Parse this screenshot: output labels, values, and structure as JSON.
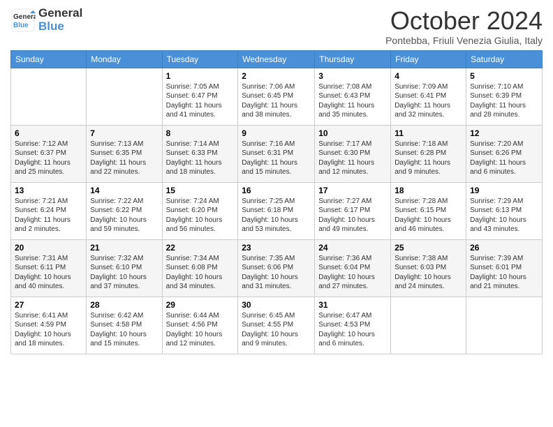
{
  "logo": {
    "general": "General",
    "blue": "Blue"
  },
  "header": {
    "month": "October 2024",
    "location": "Pontebba, Friuli Venezia Giulia, Italy"
  },
  "weekdays": [
    "Sunday",
    "Monday",
    "Tuesday",
    "Wednesday",
    "Thursday",
    "Friday",
    "Saturday"
  ],
  "weeks": [
    [
      {
        "day": "",
        "sunrise": "",
        "sunset": "",
        "daylight": ""
      },
      {
        "day": "",
        "sunrise": "",
        "sunset": "",
        "daylight": ""
      },
      {
        "day": "1",
        "sunrise": "Sunrise: 7:05 AM",
        "sunset": "Sunset: 6:47 PM",
        "daylight": "Daylight: 11 hours and 41 minutes."
      },
      {
        "day": "2",
        "sunrise": "Sunrise: 7:06 AM",
        "sunset": "Sunset: 6:45 PM",
        "daylight": "Daylight: 11 hours and 38 minutes."
      },
      {
        "day": "3",
        "sunrise": "Sunrise: 7:08 AM",
        "sunset": "Sunset: 6:43 PM",
        "daylight": "Daylight: 11 hours and 35 minutes."
      },
      {
        "day": "4",
        "sunrise": "Sunrise: 7:09 AM",
        "sunset": "Sunset: 6:41 PM",
        "daylight": "Daylight: 11 hours and 32 minutes."
      },
      {
        "day": "5",
        "sunrise": "Sunrise: 7:10 AM",
        "sunset": "Sunset: 6:39 PM",
        "daylight": "Daylight: 11 hours and 28 minutes."
      }
    ],
    [
      {
        "day": "6",
        "sunrise": "Sunrise: 7:12 AM",
        "sunset": "Sunset: 6:37 PM",
        "daylight": "Daylight: 11 hours and 25 minutes."
      },
      {
        "day": "7",
        "sunrise": "Sunrise: 7:13 AM",
        "sunset": "Sunset: 6:35 PM",
        "daylight": "Daylight: 11 hours and 22 minutes."
      },
      {
        "day": "8",
        "sunrise": "Sunrise: 7:14 AM",
        "sunset": "Sunset: 6:33 PM",
        "daylight": "Daylight: 11 hours and 18 minutes."
      },
      {
        "day": "9",
        "sunrise": "Sunrise: 7:16 AM",
        "sunset": "Sunset: 6:31 PM",
        "daylight": "Daylight: 11 hours and 15 minutes."
      },
      {
        "day": "10",
        "sunrise": "Sunrise: 7:17 AM",
        "sunset": "Sunset: 6:30 PM",
        "daylight": "Daylight: 11 hours and 12 minutes."
      },
      {
        "day": "11",
        "sunrise": "Sunrise: 7:18 AM",
        "sunset": "Sunset: 6:28 PM",
        "daylight": "Daylight: 11 hours and 9 minutes."
      },
      {
        "day": "12",
        "sunrise": "Sunrise: 7:20 AM",
        "sunset": "Sunset: 6:26 PM",
        "daylight": "Daylight: 11 hours and 6 minutes."
      }
    ],
    [
      {
        "day": "13",
        "sunrise": "Sunrise: 7:21 AM",
        "sunset": "Sunset: 6:24 PM",
        "daylight": "Daylight: 11 hours and 2 minutes."
      },
      {
        "day": "14",
        "sunrise": "Sunrise: 7:22 AM",
        "sunset": "Sunset: 6:22 PM",
        "daylight": "Daylight: 10 hours and 59 minutes."
      },
      {
        "day": "15",
        "sunrise": "Sunrise: 7:24 AM",
        "sunset": "Sunset: 6:20 PM",
        "daylight": "Daylight: 10 hours and 56 minutes."
      },
      {
        "day": "16",
        "sunrise": "Sunrise: 7:25 AM",
        "sunset": "Sunset: 6:18 PM",
        "daylight": "Daylight: 10 hours and 53 minutes."
      },
      {
        "day": "17",
        "sunrise": "Sunrise: 7:27 AM",
        "sunset": "Sunset: 6:17 PM",
        "daylight": "Daylight: 10 hours and 49 minutes."
      },
      {
        "day": "18",
        "sunrise": "Sunrise: 7:28 AM",
        "sunset": "Sunset: 6:15 PM",
        "daylight": "Daylight: 10 hours and 46 minutes."
      },
      {
        "day": "19",
        "sunrise": "Sunrise: 7:29 AM",
        "sunset": "Sunset: 6:13 PM",
        "daylight": "Daylight: 10 hours and 43 minutes."
      }
    ],
    [
      {
        "day": "20",
        "sunrise": "Sunrise: 7:31 AM",
        "sunset": "Sunset: 6:11 PM",
        "daylight": "Daylight: 10 hours and 40 minutes."
      },
      {
        "day": "21",
        "sunrise": "Sunrise: 7:32 AM",
        "sunset": "Sunset: 6:10 PM",
        "daylight": "Daylight: 10 hours and 37 minutes."
      },
      {
        "day": "22",
        "sunrise": "Sunrise: 7:34 AM",
        "sunset": "Sunset: 6:08 PM",
        "daylight": "Daylight: 10 hours and 34 minutes."
      },
      {
        "day": "23",
        "sunrise": "Sunrise: 7:35 AM",
        "sunset": "Sunset: 6:06 PM",
        "daylight": "Daylight: 10 hours and 31 minutes."
      },
      {
        "day": "24",
        "sunrise": "Sunrise: 7:36 AM",
        "sunset": "Sunset: 6:04 PM",
        "daylight": "Daylight: 10 hours and 27 minutes."
      },
      {
        "day": "25",
        "sunrise": "Sunrise: 7:38 AM",
        "sunset": "Sunset: 6:03 PM",
        "daylight": "Daylight: 10 hours and 24 minutes."
      },
      {
        "day": "26",
        "sunrise": "Sunrise: 7:39 AM",
        "sunset": "Sunset: 6:01 PM",
        "daylight": "Daylight: 10 hours and 21 minutes."
      }
    ],
    [
      {
        "day": "27",
        "sunrise": "Sunrise: 6:41 AM",
        "sunset": "Sunset: 4:59 PM",
        "daylight": "Daylight: 10 hours and 18 minutes."
      },
      {
        "day": "28",
        "sunrise": "Sunrise: 6:42 AM",
        "sunset": "Sunset: 4:58 PM",
        "daylight": "Daylight: 10 hours and 15 minutes."
      },
      {
        "day": "29",
        "sunrise": "Sunrise: 6:44 AM",
        "sunset": "Sunset: 4:56 PM",
        "daylight": "Daylight: 10 hours and 12 minutes."
      },
      {
        "day": "30",
        "sunrise": "Sunrise: 6:45 AM",
        "sunset": "Sunset: 4:55 PM",
        "daylight": "Daylight: 10 hours and 9 minutes."
      },
      {
        "day": "31",
        "sunrise": "Sunrise: 6:47 AM",
        "sunset": "Sunset: 4:53 PM",
        "daylight": "Daylight: 10 hours and 6 minutes."
      },
      {
        "day": "",
        "sunrise": "",
        "sunset": "",
        "daylight": ""
      },
      {
        "day": "",
        "sunrise": "",
        "sunset": "",
        "daylight": ""
      }
    ]
  ]
}
